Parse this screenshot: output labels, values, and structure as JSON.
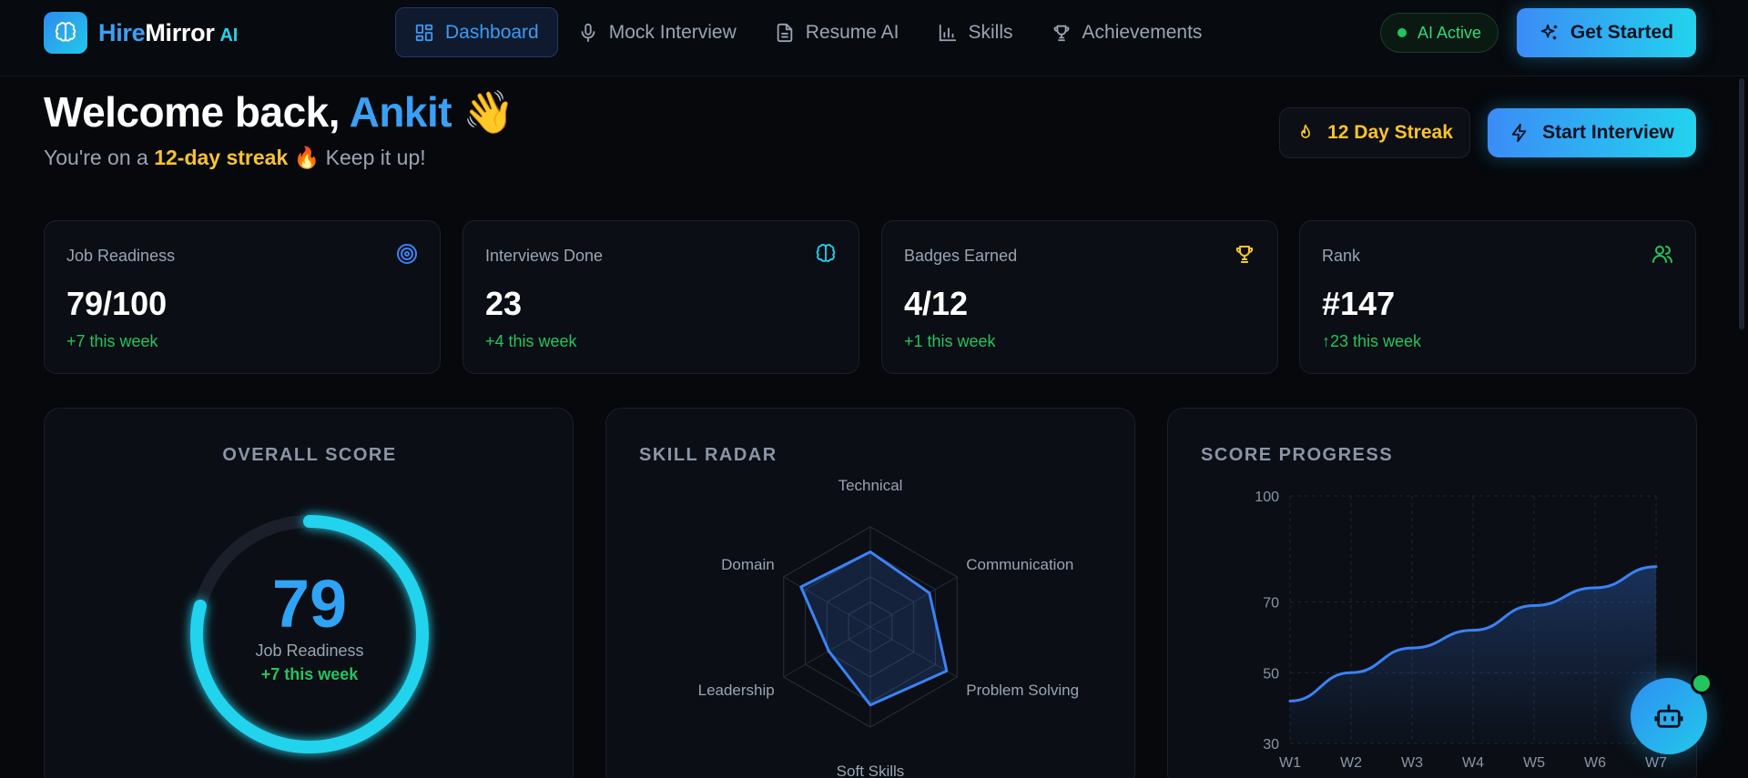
{
  "brand": {
    "hire": "Hire",
    "mirror": "Mirror",
    "ai": "AI"
  },
  "nav": [
    {
      "label": "Dashboard",
      "icon": "dashboard-icon",
      "active": true
    },
    {
      "label": "Mock Interview",
      "icon": "microphone-icon",
      "active": false
    },
    {
      "label": "Resume AI",
      "icon": "document-icon",
      "active": false
    },
    {
      "label": "Skills",
      "icon": "bar-chart-icon",
      "active": false
    },
    {
      "label": "Achievements",
      "icon": "trophy-icon",
      "active": false
    }
  ],
  "status": {
    "label": "AI Active"
  },
  "cta": {
    "get_started": "Get Started",
    "start_interview": "Start Interview"
  },
  "hero": {
    "welcome": "Welcome back, ",
    "name": "Ankit",
    "wave": "👋",
    "sub_prefix": "You're on a ",
    "sub_streak": "12-day streak",
    "sub_fire": "🔥",
    "sub_suffix": " Keep it up!",
    "streak_badge": "12 Day Streak"
  },
  "stats": [
    {
      "label": "Job Readiness",
      "value": "79/100",
      "delta": "+7 this week",
      "icon": "target-icon"
    },
    {
      "label": "Interviews Done",
      "value": "23",
      "delta": "+4 this week",
      "icon": "brain-icon"
    },
    {
      "label": "Badges Earned",
      "value": "4/12",
      "delta": "+1 this week",
      "icon": "trophy-icon"
    },
    {
      "label": "Rank",
      "value": "#147",
      "delta": "↑23 this week",
      "icon": "users-icon"
    }
  ],
  "overall": {
    "title": "OVERALL SCORE",
    "score": "79",
    "score_value": 79,
    "max": 100,
    "label": "Job Readiness",
    "delta": "+7 this week"
  },
  "radar": {
    "title": "SKILL RADAR",
    "axes": [
      "Technical",
      "Communication",
      "Problem Solving",
      "Soft Skills",
      "Leadership",
      "Domain"
    ],
    "values": [
      75,
      68,
      88,
      78,
      48,
      80
    ],
    "max": 100
  },
  "chart_data": {
    "type": "area",
    "title": "SCORE PROGRESS",
    "categories": [
      "W1",
      "W2",
      "W3",
      "W4",
      "W5",
      "W6",
      "W7"
    ],
    "values": [
      42,
      50,
      57,
      62,
      69,
      74,
      80
    ],
    "yticks": [
      30,
      50,
      70,
      100
    ],
    "ylim": [
      30,
      100
    ],
    "grid": true
  },
  "colors": {
    "accent": "#3b82f6",
    "cyan": "#22d3ee",
    "green": "#22c55e",
    "gold": "#f7c331"
  }
}
